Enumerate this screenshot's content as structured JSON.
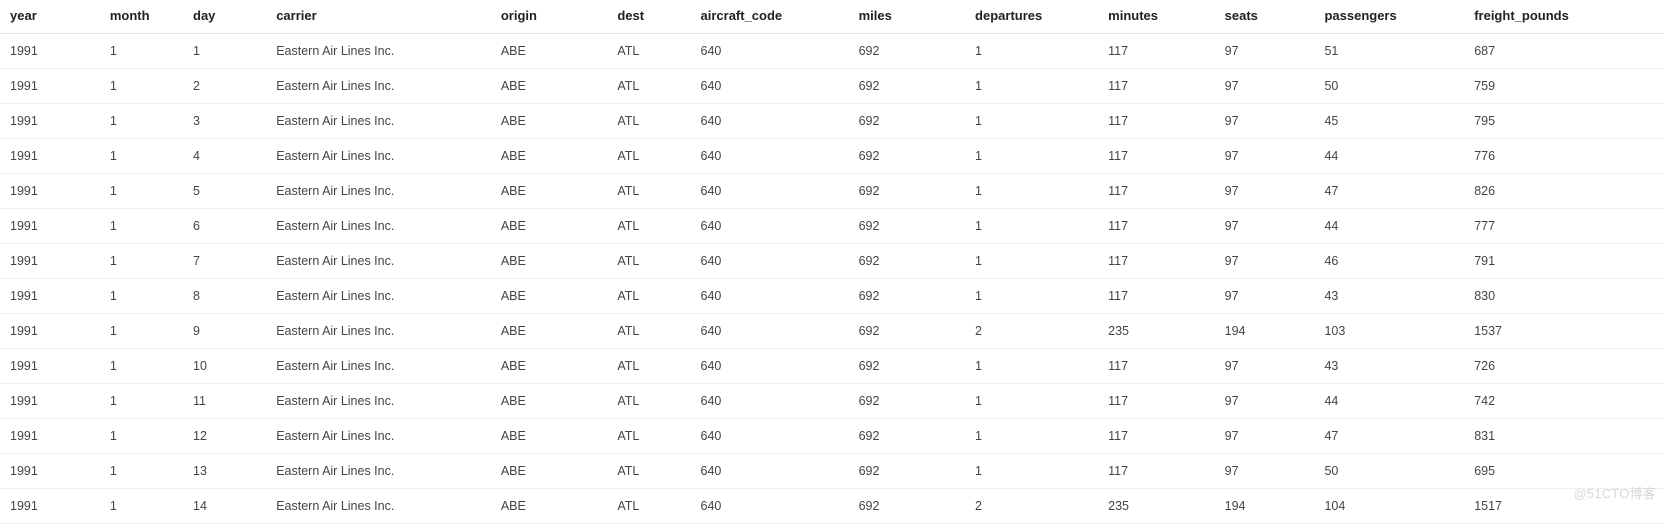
{
  "table": {
    "columns": [
      {
        "key": "year",
        "label": "year"
      },
      {
        "key": "month",
        "label": "month"
      },
      {
        "key": "day",
        "label": "day"
      },
      {
        "key": "carrier",
        "label": "carrier"
      },
      {
        "key": "origin",
        "label": "origin"
      },
      {
        "key": "dest",
        "label": "dest"
      },
      {
        "key": "aircraft_code",
        "label": "aircraft_code"
      },
      {
        "key": "miles",
        "label": "miles"
      },
      {
        "key": "departures",
        "label": "departures"
      },
      {
        "key": "minutes",
        "label": "minutes"
      },
      {
        "key": "seats",
        "label": "seats"
      },
      {
        "key": "passengers",
        "label": "passengers"
      },
      {
        "key": "freight_pounds",
        "label": "freight_pounds"
      }
    ],
    "rows": [
      {
        "year": "1991",
        "month": "1",
        "day": "1",
        "carrier": "Eastern Air Lines Inc.",
        "origin": "ABE",
        "dest": "ATL",
        "aircraft_code": "640",
        "miles": "692",
        "departures": "1",
        "minutes": "117",
        "seats": "97",
        "passengers": "51",
        "freight_pounds": "687"
      },
      {
        "year": "1991",
        "month": "1",
        "day": "2",
        "carrier": "Eastern Air Lines Inc.",
        "origin": "ABE",
        "dest": "ATL",
        "aircraft_code": "640",
        "miles": "692",
        "departures": "1",
        "minutes": "117",
        "seats": "97",
        "passengers": "50",
        "freight_pounds": "759"
      },
      {
        "year": "1991",
        "month": "1",
        "day": "3",
        "carrier": "Eastern Air Lines Inc.",
        "origin": "ABE",
        "dest": "ATL",
        "aircraft_code": "640",
        "miles": "692",
        "departures": "1",
        "minutes": "117",
        "seats": "97",
        "passengers": "45",
        "freight_pounds": "795"
      },
      {
        "year": "1991",
        "month": "1",
        "day": "4",
        "carrier": "Eastern Air Lines Inc.",
        "origin": "ABE",
        "dest": "ATL",
        "aircraft_code": "640",
        "miles": "692",
        "departures": "1",
        "minutes": "117",
        "seats": "97",
        "passengers": "44",
        "freight_pounds": "776"
      },
      {
        "year": "1991",
        "month": "1",
        "day": "5",
        "carrier": "Eastern Air Lines Inc.",
        "origin": "ABE",
        "dest": "ATL",
        "aircraft_code": "640",
        "miles": "692",
        "departures": "1",
        "minutes": "117",
        "seats": "97",
        "passengers": "47",
        "freight_pounds": "826"
      },
      {
        "year": "1991",
        "month": "1",
        "day": "6",
        "carrier": "Eastern Air Lines Inc.",
        "origin": "ABE",
        "dest": "ATL",
        "aircraft_code": "640",
        "miles": "692",
        "departures": "1",
        "minutes": "117",
        "seats": "97",
        "passengers": "44",
        "freight_pounds": "777"
      },
      {
        "year": "1991",
        "month": "1",
        "day": "7",
        "carrier": "Eastern Air Lines Inc.",
        "origin": "ABE",
        "dest": "ATL",
        "aircraft_code": "640",
        "miles": "692",
        "departures": "1",
        "minutes": "117",
        "seats": "97",
        "passengers": "46",
        "freight_pounds": "791"
      },
      {
        "year": "1991",
        "month": "1",
        "day": "8",
        "carrier": "Eastern Air Lines Inc.",
        "origin": "ABE",
        "dest": "ATL",
        "aircraft_code": "640",
        "miles": "692",
        "departures": "1",
        "minutes": "117",
        "seats": "97",
        "passengers": "43",
        "freight_pounds": "830"
      },
      {
        "year": "1991",
        "month": "1",
        "day": "9",
        "carrier": "Eastern Air Lines Inc.",
        "origin": "ABE",
        "dest": "ATL",
        "aircraft_code": "640",
        "miles": "692",
        "departures": "2",
        "minutes": "235",
        "seats": "194",
        "passengers": "103",
        "freight_pounds": "1537"
      },
      {
        "year": "1991",
        "month": "1",
        "day": "10",
        "carrier": "Eastern Air Lines Inc.",
        "origin": "ABE",
        "dest": "ATL",
        "aircraft_code": "640",
        "miles": "692",
        "departures": "1",
        "minutes": "117",
        "seats": "97",
        "passengers": "43",
        "freight_pounds": "726"
      },
      {
        "year": "1991",
        "month": "1",
        "day": "11",
        "carrier": "Eastern Air Lines Inc.",
        "origin": "ABE",
        "dest": "ATL",
        "aircraft_code": "640",
        "miles": "692",
        "departures": "1",
        "minutes": "117",
        "seats": "97",
        "passengers": "44",
        "freight_pounds": "742"
      },
      {
        "year": "1991",
        "month": "1",
        "day": "12",
        "carrier": "Eastern Air Lines Inc.",
        "origin": "ABE",
        "dest": "ATL",
        "aircraft_code": "640",
        "miles": "692",
        "departures": "1",
        "minutes": "117",
        "seats": "97",
        "passengers": "47",
        "freight_pounds": "831"
      },
      {
        "year": "1991",
        "month": "1",
        "day": "13",
        "carrier": "Eastern Air Lines Inc.",
        "origin": "ABE",
        "dest": "ATL",
        "aircraft_code": "640",
        "miles": "692",
        "departures": "1",
        "minutes": "117",
        "seats": "97",
        "passengers": "50",
        "freight_pounds": "695"
      },
      {
        "year": "1991",
        "month": "1",
        "day": "14",
        "carrier": "Eastern Air Lines Inc.",
        "origin": "ABE",
        "dest": "ATL",
        "aircraft_code": "640",
        "miles": "692",
        "departures": "2",
        "minutes": "235",
        "seats": "194",
        "passengers": "104",
        "freight_pounds": "1517"
      }
    ]
  },
  "watermark": "@51CTO博客"
}
